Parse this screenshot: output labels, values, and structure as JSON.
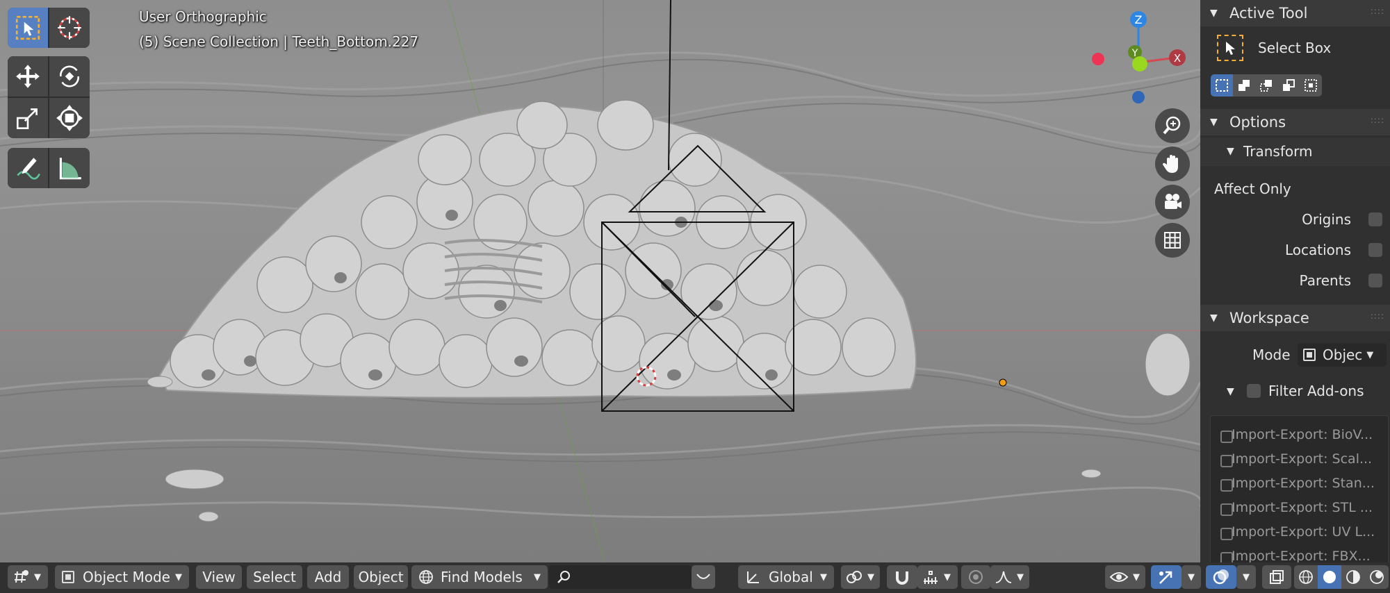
{
  "viewport": {
    "view_name": "User Orthographic",
    "collection_info": "(5) Scene Collection | Teeth_Bottom.227"
  },
  "gizmo": {
    "z": "Z",
    "y": "Y",
    "x": "X"
  },
  "sidebar": {
    "active_tool": {
      "header": "Active Tool",
      "tool_name": "Select Box",
      "mode_icons": [
        "select-new-icon",
        "select-extend-icon",
        "select-subtract-icon",
        "select-difference-icon",
        "select-intersect-icon"
      ]
    },
    "options": {
      "header": "Options",
      "transform_header": "Transform",
      "affect_only": "Affect Only",
      "origins": "Origins",
      "locations": "Locations",
      "parents": "Parents"
    },
    "workspace": {
      "header": "Workspace",
      "mode_label": "Mode",
      "mode_value": "Objec",
      "filter_addons": "Filter Add-ons",
      "addons": [
        "Import-Export: BioV...",
        "Import-Export: Scal...",
        "Import-Export: Stan...",
        "Import-Export: STL ...",
        "Import-Export: UV L...",
        "Import-Export: FBX..."
      ]
    }
  },
  "header_bar": {
    "object_mode": "Object Mode",
    "view": "View",
    "select": "Select",
    "add": "Add",
    "object": "Object",
    "find_models": "Find Models",
    "transform_orientation": "Global"
  },
  "colors": {
    "accent_blue": "#5680c2",
    "axis_x": "#d44a52",
    "axis_y": "#82c026",
    "axis_z": "#2d86e3",
    "panel_bg": "#303030"
  }
}
